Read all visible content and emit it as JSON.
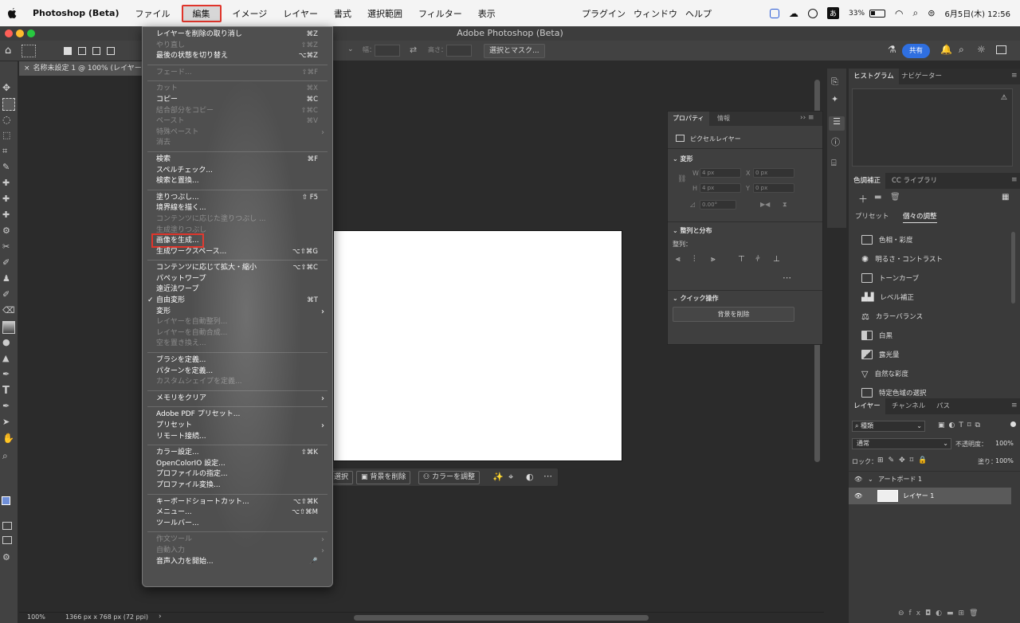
{
  "macbar": {
    "app": "Photoshop (Beta)",
    "menus": [
      "ファイル",
      "編集",
      "イメージ",
      "レイヤー",
      "書式",
      "選択範囲",
      "フィルター",
      "表示"
    ],
    "right_menus": [
      "プラグイン",
      "ウィンドウ",
      "ヘルプ"
    ],
    "ime": "あ",
    "battery": "33%",
    "datetime": "6月5日(木) 12:56"
  },
  "window": {
    "title": "Adobe Photoshop (Beta)"
  },
  "options": {
    "width_label": "幅：",
    "height_label": "高さ：",
    "select_mask": "選択とマスク...",
    "share": "共有"
  },
  "document": {
    "tab": "名称未設定 1 @ 100% (レイヤー",
    "zoom": "100%",
    "info": "1366 px x 768 px (72 ppi)"
  },
  "context_bar": {
    "select": "選択",
    "remove_bg": "背景を削除",
    "adjust_color": "カラーを調整"
  },
  "properties": {
    "tabs": [
      "プロパティ",
      "情報"
    ],
    "layer_type": "ピクセルレイヤー",
    "transform": "変形",
    "w": "W",
    "w_val": "4 px",
    "x": "X",
    "x_val": "0 px",
    "h": "H",
    "h_val": "4 px",
    "y": "Y",
    "y_val": "0 px",
    "angle": "0.00°",
    "align_section": "整列と分布",
    "align_label": "整列：",
    "quick_section": "クイック操作",
    "remove_bg": "背景を削除"
  },
  "right": {
    "tabs_top": [
      "ヒストグラム",
      "ナビゲーター"
    ],
    "tabs_adj": [
      "色調補正",
      "CC ライブラリ"
    ],
    "sub_tabs": [
      "プリセット",
      "個々の調整"
    ],
    "adjustments": [
      "色相・彩度",
      "明るさ・コントラスト",
      "トーンカーブ",
      "レベル補正",
      "カラーバランス",
      "白黒",
      "露光量",
      "自然な彩度",
      "特定色域の選択"
    ],
    "tabs_layers": [
      "レイヤー",
      "チャンネル",
      "パス"
    ],
    "kind": "種類",
    "blend_mode": "通常",
    "opacity_label": "不透明度：",
    "opacity": "100%",
    "lock_label": "ロック：",
    "fill_label": "塗り：",
    "fill": "100%",
    "artboard": "アートボード 1",
    "layer": "レイヤー 1"
  },
  "edit_menu": {
    "items": [
      {
        "label": "レイヤーを削除の取り消し",
        "sc": "⌘Z",
        "dis": false
      },
      {
        "label": "やり直し",
        "sc": "⇧⌘Z",
        "dis": true
      },
      {
        "label": "最後の状態を切り替え",
        "sc": "⌥⌘Z",
        "dis": false
      },
      {
        "sep": true
      },
      {
        "label": "フェード...",
        "sc": "⇧⌘F",
        "dis": true
      },
      {
        "sep": true
      },
      {
        "label": "カット",
        "sc": "⌘X",
        "dis": true
      },
      {
        "label": "コピー",
        "sc": "⌘C",
        "dis": false
      },
      {
        "label": "結合部分をコピー",
        "sc": "⇧⌘C",
        "dis": true
      },
      {
        "label": "ペースト",
        "sc": "⌘V",
        "dis": true
      },
      {
        "label": "特殊ペースト",
        "arrow": true,
        "dis": true
      },
      {
        "label": "消去",
        "dis": true
      },
      {
        "sep": true
      },
      {
        "label": "検索",
        "sc": "⌘F",
        "dis": false
      },
      {
        "label": "スペルチェック...",
        "dis": false
      },
      {
        "label": "検索と置換...",
        "dis": false
      },
      {
        "sep": true
      },
      {
        "label": "塗りつぶし...",
        "sc": "⇧ F5",
        "dis": false
      },
      {
        "label": "境界線を描く...",
        "dis": false
      },
      {
        "label": "コンテンツに応じた塗りつぶし ...",
        "dis": true
      },
      {
        "label": "生成塗りつぶし",
        "dis": true
      },
      {
        "label": "画像を生成...",
        "dis": false,
        "hl": true
      },
      {
        "label": "生成ワークスペース...",
        "sc": "⌥⇧⌘G",
        "dis": false
      },
      {
        "sep": true
      },
      {
        "label": "コンテンツに応じて拡大・縮小",
        "sc": "⌥⇧⌘C",
        "dis": false
      },
      {
        "label": "パペットワープ",
        "dis": false
      },
      {
        "label": "遠近法ワープ",
        "dis": false
      },
      {
        "label": "自由変形",
        "sc": "⌘T",
        "dis": false,
        "check": true
      },
      {
        "label": "変形",
        "arrow": true,
        "dis": false
      },
      {
        "label": "レイヤーを自動整列...",
        "dis": true
      },
      {
        "label": "レイヤーを自動合成...",
        "dis": true
      },
      {
        "label": "空を置き換え...",
        "dis": true
      },
      {
        "sep": true
      },
      {
        "label": "ブラシを定義...",
        "dis": false
      },
      {
        "label": "パターンを定義...",
        "dis": false
      },
      {
        "label": "カスタムシェイプを定義...",
        "dis": true
      },
      {
        "sep": true
      },
      {
        "label": "メモリをクリア",
        "arrow": true,
        "dis": false
      },
      {
        "sep": true
      },
      {
        "label": "Adobe PDF プリセット...",
        "dis": false
      },
      {
        "label": "プリセット",
        "arrow": true,
        "dis": false
      },
      {
        "label": "リモート接続...",
        "dis": false
      },
      {
        "sep": true
      },
      {
        "label": "カラー設定...",
        "sc": "⇧⌘K",
        "dis": false
      },
      {
        "label": "OpenColorIO 設定...",
        "dis": false
      },
      {
        "label": "プロファイルの指定...",
        "dis": false
      },
      {
        "label": "プロファイル変換...",
        "dis": false
      },
      {
        "sep": true
      },
      {
        "label": "キーボードショートカット...",
        "sc": "⌥⇧⌘K",
        "dis": false
      },
      {
        "label": "メニュー...",
        "sc": "⌥⇧⌘M",
        "dis": false
      },
      {
        "label": "ツールバー...",
        "dis": false
      },
      {
        "sep": true
      },
      {
        "label": "作文ツール",
        "arrow": true,
        "dis": true
      },
      {
        "label": "自動入力",
        "arrow": true,
        "dis": true
      },
      {
        "label": "音声入力を開始...",
        "sc": "🎤",
        "dis": false
      }
    ]
  }
}
